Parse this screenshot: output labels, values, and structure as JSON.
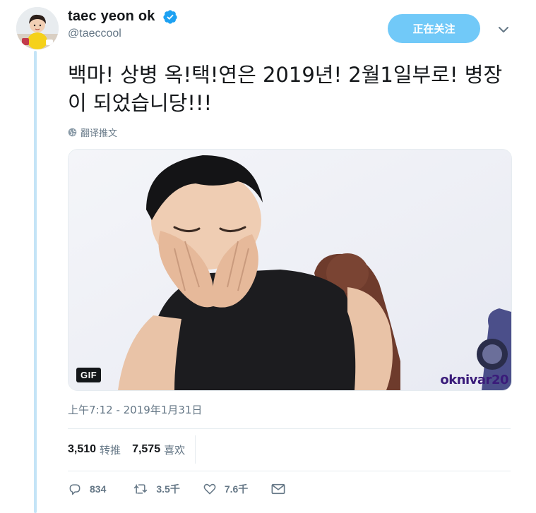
{
  "user": {
    "display_name": "taec yeon ok",
    "handle": "@taeccool",
    "follow_label": "正在关注"
  },
  "tweet": {
    "text": "백마! 상병 옥!택!연은 2019년! 2월1일부로! 병장이 되었습니당!!!",
    "translate_label": "翻译推文",
    "media_badge": "GIF",
    "media_watermark": "oknivar20",
    "timestamp": "上午7:12 - 2019年1月31日"
  },
  "stats": {
    "retweets_count": "3,510",
    "retweets_label": "转推",
    "likes_count": "7,575",
    "likes_label": "喜欢"
  },
  "actions": {
    "replies": "834",
    "retweets": "3.5千",
    "likes": "7.6千"
  },
  "colors": {
    "accent": "#1da1f2",
    "follow_button": "#71c9f8",
    "thread_line": "#c4e4f7",
    "secondary_text": "#657786"
  }
}
